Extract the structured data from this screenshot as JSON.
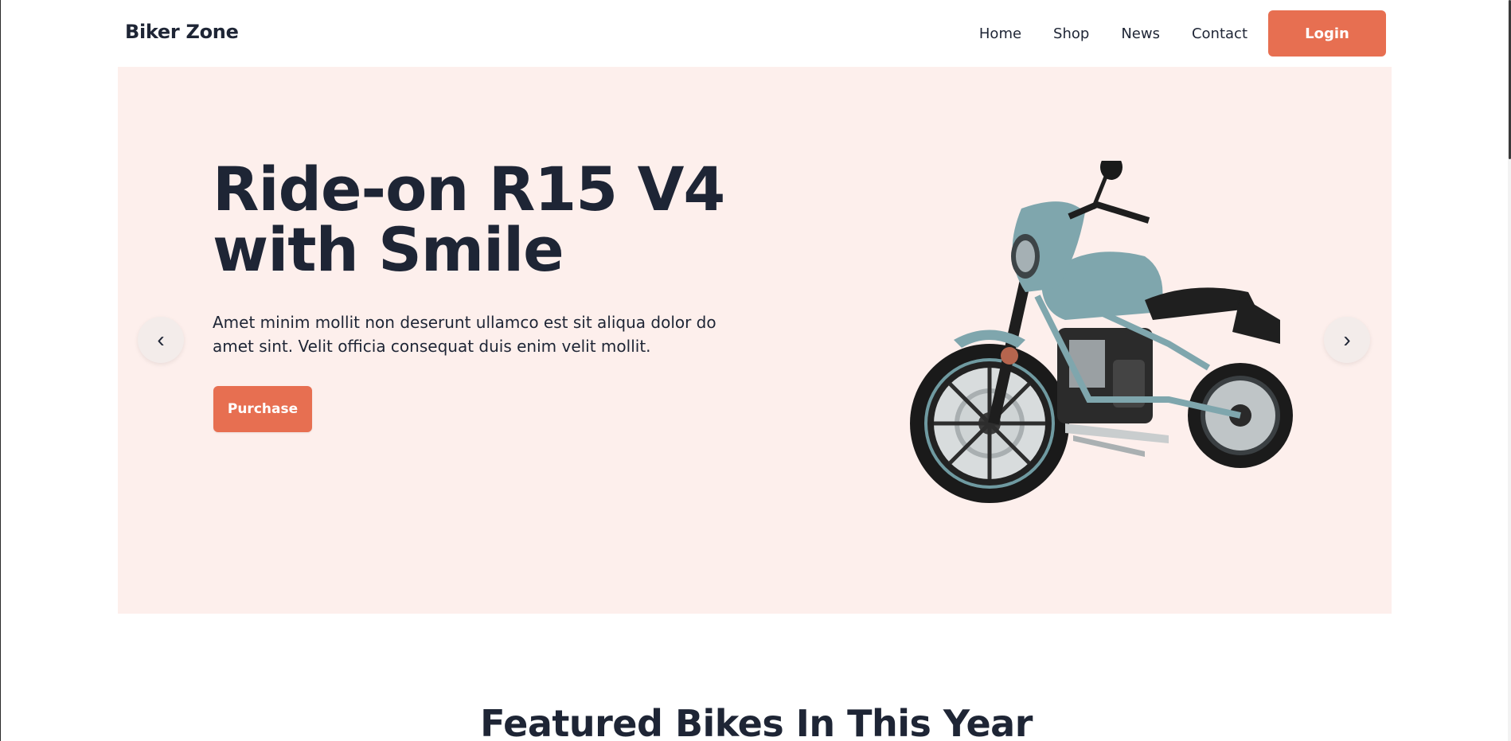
{
  "header": {
    "brand": "Biker Zone",
    "nav": [
      "Home",
      "Shop",
      "News",
      "Contact"
    ],
    "login_label": "Login"
  },
  "hero": {
    "title_line1": "Ride-on R15 V4",
    "title_line2": "with Smile",
    "description": "Amet minim mollit non deserunt ullamco est sit aliqua dolor do amet sint. Velit officia consequat duis enim velit mollit.",
    "purchase_label": "Purchase",
    "prev_arrow": "‹",
    "next_arrow": "›",
    "image_icon": "motorcycle-image"
  },
  "featured": {
    "title": "Featured Bikes In This Year"
  },
  "colors": {
    "accent": "#e76f51",
    "hero_bg": "#fdefec",
    "heading": "#1e2535",
    "bike_body": "#7fa6ad"
  }
}
